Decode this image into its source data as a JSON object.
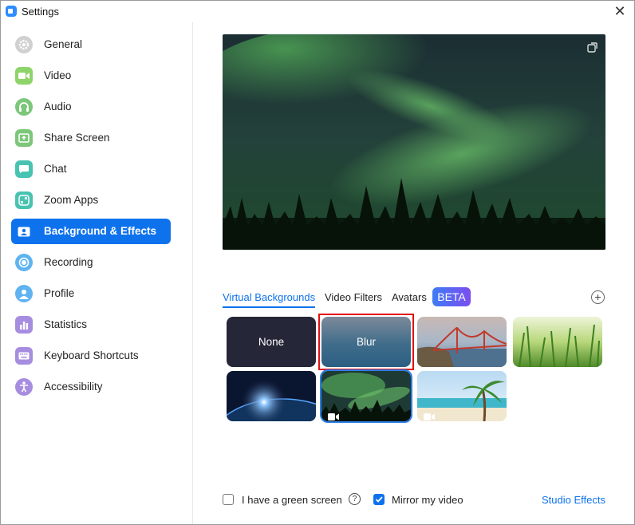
{
  "window": {
    "title": "Settings"
  },
  "sidebar": {
    "items": [
      {
        "label": "General",
        "icon": "gear-icon",
        "color": "#c7c7c7"
      },
      {
        "label": "Video",
        "icon": "video-icon",
        "color": "#8ed46a"
      },
      {
        "label": "Audio",
        "icon": "headphones-icon",
        "color": "#7cc77a"
      },
      {
        "label": "Share Screen",
        "icon": "share-screen-icon",
        "color": "#7cc77a"
      },
      {
        "label": "Chat",
        "icon": "chat-icon",
        "color": "#49c3b1"
      },
      {
        "label": "Zoom Apps",
        "icon": "apps-icon",
        "color": "#49c3b1"
      },
      {
        "label": "Background & Effects",
        "icon": "person-card-icon",
        "color": "#0e72ed"
      },
      {
        "label": "Recording",
        "icon": "record-icon",
        "color": "#5fb3f0"
      },
      {
        "label": "Profile",
        "icon": "profile-icon",
        "color": "#5fb3f0"
      },
      {
        "label": "Statistics",
        "icon": "bar-chart-icon",
        "color": "#a78de0"
      },
      {
        "label": "Keyboard Shortcuts",
        "icon": "keyboard-icon",
        "color": "#a78de0"
      },
      {
        "label": "Accessibility",
        "icon": "accessibility-icon",
        "color": "#a78de0"
      }
    ],
    "active_index": 6
  },
  "tabs": [
    {
      "label": "Virtual Backgrounds",
      "active": true
    },
    {
      "label": "Video Filters",
      "active": false
    },
    {
      "label": "Avatars",
      "active": false
    }
  ],
  "beta_badge": "BETA",
  "backgrounds": [
    {
      "label": "None"
    },
    {
      "label": "Blur"
    },
    {
      "label": ""
    },
    {
      "label": ""
    },
    {
      "label": ""
    },
    {
      "label": ""
    },
    {
      "label": ""
    }
  ],
  "footer": {
    "green_screen_label": "I have a green screen",
    "green_screen_checked": false,
    "mirror_label": "Mirror my video",
    "mirror_checked": true,
    "studio_effects": "Studio Effects"
  },
  "colors": {
    "accent": "#0e72ed",
    "highlight": "#e11111"
  }
}
